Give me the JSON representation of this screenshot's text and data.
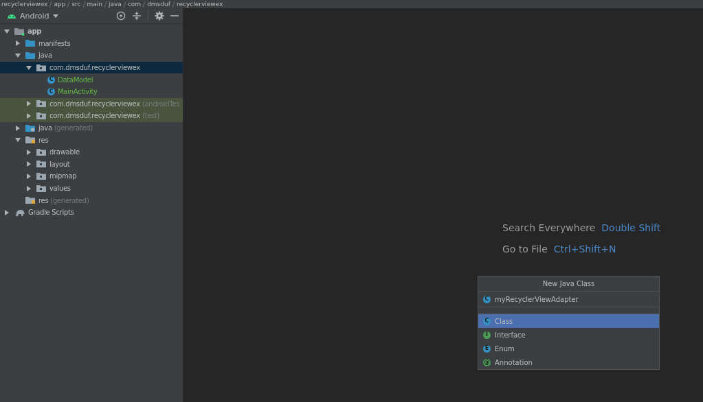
{
  "breadcrumb": [
    "recyclerviewex",
    "app",
    "src",
    "main",
    "java",
    "com",
    "dmsduf",
    "recyclerviewex"
  ],
  "project_panel": {
    "view": "Android",
    "tree": [
      {
        "label": "app",
        "kind": "module",
        "expanded": true,
        "selected": false,
        "highlighted": false,
        "children": [
          {
            "label": "manifests",
            "kind": "folder",
            "expanded": false,
            "selected": false,
            "highlighted": false
          },
          {
            "label": "java",
            "kind": "folder",
            "expanded": true,
            "selected": false,
            "highlighted": false,
            "children": [
              {
                "label": "com.dmsduf.recyclerviewex",
                "kind": "package",
                "expanded": true,
                "selected": true,
                "highlighted": false,
                "children": [
                  {
                    "label": "DataModel",
                    "kind": "class",
                    "icon_letter": "C",
                    "selected": false,
                    "highlighted": false
                  },
                  {
                    "label": "MainActivity",
                    "kind": "class",
                    "icon_letter": "C",
                    "selected": false,
                    "highlighted": false
                  }
                ]
              },
              {
                "label": "com.dmsduf.recyclerviewex",
                "suffix": "(androidTes",
                "kind": "package",
                "expanded": false,
                "selected": false,
                "highlighted": true
              },
              {
                "label": "com.dmsduf.recyclerviewex",
                "suffix": "(test)",
                "kind": "package",
                "expanded": false,
                "selected": false,
                "highlighted": true
              }
            ]
          },
          {
            "label": "java",
            "suffix": "(generated)",
            "kind": "gen-folder",
            "expanded": false,
            "selected": false,
            "highlighted": false
          },
          {
            "label": "res",
            "kind": "res-folder",
            "expanded": true,
            "selected": false,
            "highlighted": false,
            "children": [
              {
                "label": "drawable",
                "kind": "package",
                "expanded": false,
                "selected": false,
                "highlighted": false
              },
              {
                "label": "layout",
                "kind": "package",
                "expanded": false,
                "selected": false,
                "highlighted": false
              },
              {
                "label": "mipmap",
                "kind": "package",
                "expanded": false,
                "selected": false,
                "highlighted": false
              },
              {
                "label": "values",
                "kind": "package",
                "expanded": false,
                "selected": false,
                "highlighted": false
              }
            ]
          },
          {
            "label": "res",
            "suffix": "(generated)",
            "kind": "res-folder",
            "selected": false,
            "highlighted": false
          }
        ]
      },
      {
        "label": "Gradle Scripts",
        "kind": "gradle",
        "expanded": false,
        "selected": false,
        "highlighted": false
      }
    ]
  },
  "hints": [
    {
      "action": "Search Everywhere",
      "shortcut": "Double Shift"
    },
    {
      "action": "Go to File",
      "shortcut": "Ctrl+Shift+N"
    }
  ],
  "new_class_dialog": {
    "title": "New Java Class",
    "value": "myRecyclerViewAdapter",
    "value_icon_letter": "C",
    "options": [
      {
        "label": "Class",
        "kind": "class",
        "icon_letter": "C",
        "selected": true
      },
      {
        "label": "Interface",
        "kind": "interface",
        "icon_letter": "I",
        "selected": false
      },
      {
        "label": "Enum",
        "kind": "enum",
        "icon_letter": "E",
        "selected": false
      },
      {
        "label": "Annotation",
        "kind": "annotation",
        "icon_letter": "@",
        "selected": false
      }
    ]
  }
}
